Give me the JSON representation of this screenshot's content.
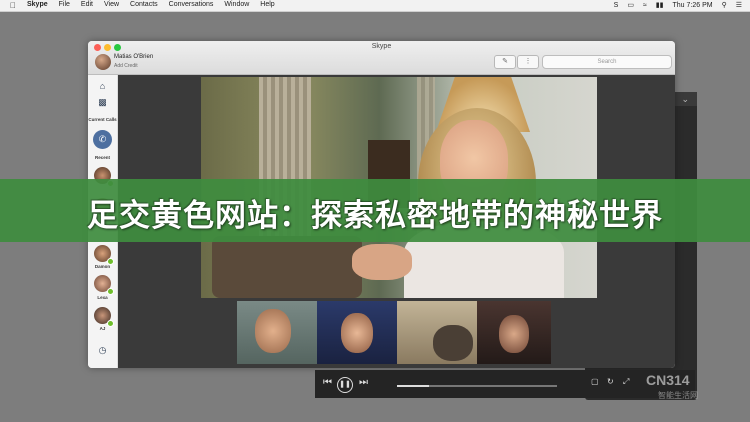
{
  "menubar": {
    "apple": "",
    "items": [
      "Skype",
      "File",
      "Edit",
      "View",
      "Contacts",
      "Conversations",
      "Window",
      "Help"
    ],
    "clock": "Thu 7:26 PM"
  },
  "window": {
    "title": "Skype",
    "user_name": "Matias O'Brien",
    "credit_link": "Add Credit",
    "search_placeholder": "Search"
  },
  "sidebar": {
    "current_calls_label": "Current Calls",
    "recent_label": "Recent",
    "contacts": [
      "Damon",
      "Lexa",
      "AJ"
    ]
  },
  "media": {
    "progress": 0.2
  },
  "banner": {
    "text": "足交黄色网站：探索私密地带的神秘世界"
  },
  "watermark": {
    "text": "CN314",
    "sub": "智能生活网"
  },
  "colors": {
    "banner": "#3e8c3e",
    "online": "#6fbf2b"
  }
}
